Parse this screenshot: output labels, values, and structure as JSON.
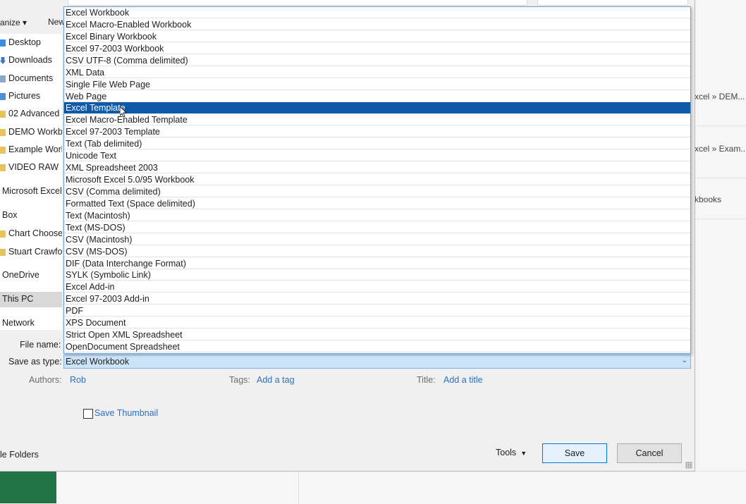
{
  "background": {
    "breadcrumbs": [
      "xcel » DEM...",
      "xcel » Exam...",
      "kbooks"
    ]
  },
  "toolbar": {
    "organize_label": "anize ▾",
    "new_label": "New"
  },
  "nav": {
    "items": [
      {
        "label": "Desktop",
        "icon": "desktop-icon"
      },
      {
        "label": "Downloads",
        "icon": "downloads-icon"
      },
      {
        "label": "Documents",
        "icon": "documents-icon"
      },
      {
        "label": "Pictures",
        "icon": "pictures-icon"
      },
      {
        "label": "02 Advanced",
        "icon": "folder-icon"
      },
      {
        "label": "DEMO Workbo",
        "icon": "folder-icon"
      },
      {
        "label": "Example Work",
        "icon": "folder-icon"
      },
      {
        "label": "VIDEO RAW",
        "icon": "folder-icon"
      },
      {
        "label": "Microsoft Excel",
        "icon": ""
      },
      {
        "label": "Box",
        "icon": ""
      },
      {
        "label": "Chart Chooser",
        "icon": "folder-icon"
      },
      {
        "label": "Stuart Crawfor",
        "icon": "folder-icon"
      },
      {
        "label": "OneDrive",
        "icon": ""
      },
      {
        "label": "This PC",
        "icon": "",
        "selected": true
      },
      {
        "label": "Network",
        "icon": ""
      }
    ]
  },
  "form": {
    "file_name_label": "File name:",
    "save_as_type_label": "Save as type:",
    "save_as_type_value": "Excel Workbook",
    "authors_label": "Authors:",
    "authors_value": "Rob",
    "tags_label": "Tags:",
    "tags_value": "Add a tag",
    "title_label": "Title:",
    "title_value": "Add a title",
    "save_thumbnail_label": "Save Thumbnail",
    "hide_folders_label": "le Folders",
    "tools_label": "Tools",
    "save_button": "Save",
    "cancel_button": "Cancel"
  },
  "dropdown": {
    "selected_index": 8,
    "options": [
      "Excel Workbook",
      "Excel Macro-Enabled Workbook",
      "Excel Binary Workbook",
      "Excel 97-2003 Workbook",
      "CSV UTF-8 (Comma delimited)",
      "XML Data",
      "Single File Web Page",
      "Web Page",
      "Excel Template",
      "Excel Macro-Enabled Template",
      "Excel 97-2003 Template",
      "Text (Tab delimited)",
      "Unicode Text",
      "XML Spreadsheet 2003",
      "Microsoft Excel 5.0/95 Workbook",
      "CSV (Comma delimited)",
      "Formatted Text (Space delimited)",
      "Text (Macintosh)",
      "Text (MS-DOS)",
      "CSV (Macintosh)",
      "CSV (MS-DOS)",
      "DIF (Data Interchange Format)",
      "SYLK (Symbolic Link)",
      "Excel Add-in",
      "Excel 97-2003 Add-in",
      "PDF",
      "XPS Document",
      "Strict Open XML Spreadsheet",
      "OpenDocument Spreadsheet"
    ]
  },
  "colors": {
    "selection": "#0e5aa8",
    "link": "#2b6fc0",
    "excel_green": "#217346"
  }
}
